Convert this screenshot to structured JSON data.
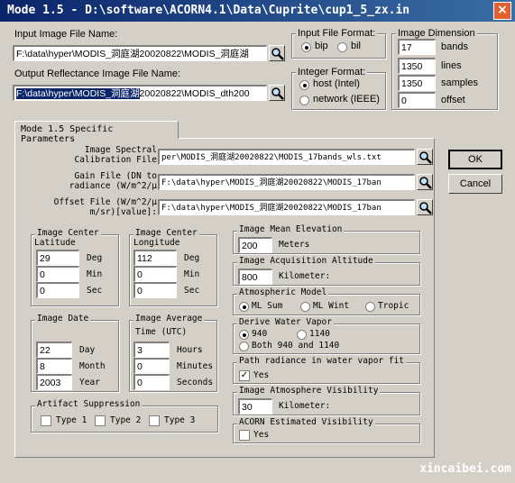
{
  "window": {
    "title": "Mode 1.5 - D:\\software\\ACORN4.1\\Data\\Cuprite\\cup1_5_zx.in",
    "close": "×"
  },
  "input_file": {
    "label": "Input Image File Name:",
    "value": "F:\\data\\hyper\\MODIS_洞庭湖20020822\\MODIS_洞庭湖"
  },
  "output_file": {
    "label": "Output Reflectance Image File Name:",
    "value_selected": "F:\\data\\hyper\\MODIS_洞庭湖",
    "value_rest": "20020822\\MODIS_dth200"
  },
  "input_format": {
    "label": "Input File Format:",
    "options": [
      "bip",
      "bil"
    ],
    "selected": "bip"
  },
  "integer_format": {
    "label": "Integer Format:",
    "options": [
      "host (Intel)",
      "network (IEEE)"
    ],
    "selected": "host (Intel)"
  },
  "image_dimension": {
    "label": "Image Dimension",
    "fields": [
      {
        "value": "17",
        "unit": "bands"
      },
      {
        "value": "1350",
        "unit": "lines"
      },
      {
        "value": "1350",
        "unit": "samples"
      },
      {
        "value": "0",
        "unit": "offset"
      }
    ]
  },
  "tab": {
    "label": "Mode 1.5 Specific Parameters"
  },
  "spectral": {
    "label1": "Image Spectral",
    "label2": "Calibration File",
    "value": "per\\MODIS_洞庭湖20020822\\MODIS_17bands_wls.txt"
  },
  "gain": {
    "label1": "Gain File (DN to",
    "label2": "radiance (W/m^2/μ",
    "value": "F:\\data\\hyper\\MODIS_洞庭湖20020822\\MODIS_17ban"
  },
  "offset": {
    "label1": "Offset File (W/m^2/μ",
    "label2": "m/sr)[value]:",
    "value": "F:\\data\\hyper\\MODIS_洞庭湖20020822\\MODIS_17ban"
  },
  "lat": {
    "title1": "Image Center",
    "title2": "Latitude",
    "rows": [
      {
        "value": "29",
        "unit": "Deg"
      },
      {
        "value": "0",
        "unit": "Min"
      },
      {
        "value": "0",
        "unit": "Sec"
      }
    ]
  },
  "lon": {
    "title1": "Image Center",
    "title2": "Longitude",
    "rows": [
      {
        "value": "112",
        "unit": "Deg"
      },
      {
        "value": "0",
        "unit": "Min"
      },
      {
        "value": "0",
        "unit": "Sec"
      }
    ]
  },
  "date": {
    "title": "Image Date",
    "rows": [
      {
        "value": "22",
        "unit": "Day"
      },
      {
        "value": "8",
        "unit": "Month"
      },
      {
        "value": "2003",
        "unit": "Year"
      }
    ]
  },
  "time": {
    "title1": "Image Average",
    "title2": "Time (UTC)",
    "rows": [
      {
        "value": "3",
        "unit": "Hours"
      },
      {
        "value": "0",
        "unit": "Minutes"
      },
      {
        "value": "0",
        "unit": "Seconds"
      }
    ]
  },
  "artifact": {
    "title": "Artifact Suppression",
    "options": [
      "Type 1",
      "Type 2",
      "Type 3"
    ]
  },
  "elevation": {
    "title": "Image Mean Elevation",
    "value": "200",
    "unit": "Meters"
  },
  "altitude": {
    "title": "Image Acquisition Altitude",
    "value": "800",
    "unit": "Kilometer:"
  },
  "atmos": {
    "title": "Atmospheric Model",
    "options": [
      "ML Sum",
      "ML Wint",
      "Tropic"
    ],
    "selected": "ML Sum"
  },
  "water": {
    "title": "Derive Water Vapor",
    "options": [
      "940",
      "1140",
      "Both 940 and 1140"
    ],
    "selected": "940"
  },
  "path": {
    "title": "Path radiance in water vapor fit",
    "option": "Yes",
    "checked": true
  },
  "visibility": {
    "title": "Image Atmosphere Visibility",
    "value": "30",
    "unit": "Kilometer:"
  },
  "acorn_vis": {
    "title": "ACORN Estimated Visibility",
    "option": "Yes"
  },
  "buttons": {
    "ok": "OK",
    "cancel": "Cancel"
  },
  "watermark": "xincaibei.com"
}
